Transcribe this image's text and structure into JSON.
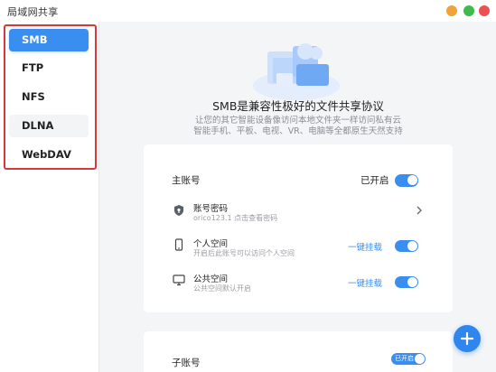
{
  "window": {
    "title": "局域网共享"
  },
  "sidebar": {
    "items": [
      {
        "label": "SMB"
      },
      {
        "label": "FTP"
      },
      {
        "label": "NFS"
      },
      {
        "label": "DLNA"
      },
      {
        "label": "WebDAV"
      }
    ]
  },
  "main": {
    "headline": "SMB是兼容性极好的文件共享协议",
    "subtext_line1": "让您的其它智能设备像访问本地文件夹一样访问私有云",
    "subtext_line2": "智能手机、平板、电视、VR、电脑等全都原生天然支持",
    "main_account": {
      "label": "主账号",
      "status": "已开启",
      "enabled": true
    },
    "rows": [
      {
        "title": "账号密码",
        "sub": "orico123.1 点击查看密码",
        "icon": "shield-lock-icon"
      },
      {
        "title": "个人空间",
        "sub": "开启后此账号可以访问个人空间",
        "link": "一键挂载",
        "enabled": true,
        "icon": "phone-icon"
      },
      {
        "title": "公共空间",
        "sub": "公共空间默认开启",
        "link": "一键挂载",
        "enabled": true,
        "icon": "monitor-icon"
      }
    ],
    "sub_account": {
      "label": "子账号",
      "status": "已开启",
      "enabled": true
    }
  },
  "colors": {
    "accent": "#3a8ef0",
    "highlight": "#d9383a"
  }
}
